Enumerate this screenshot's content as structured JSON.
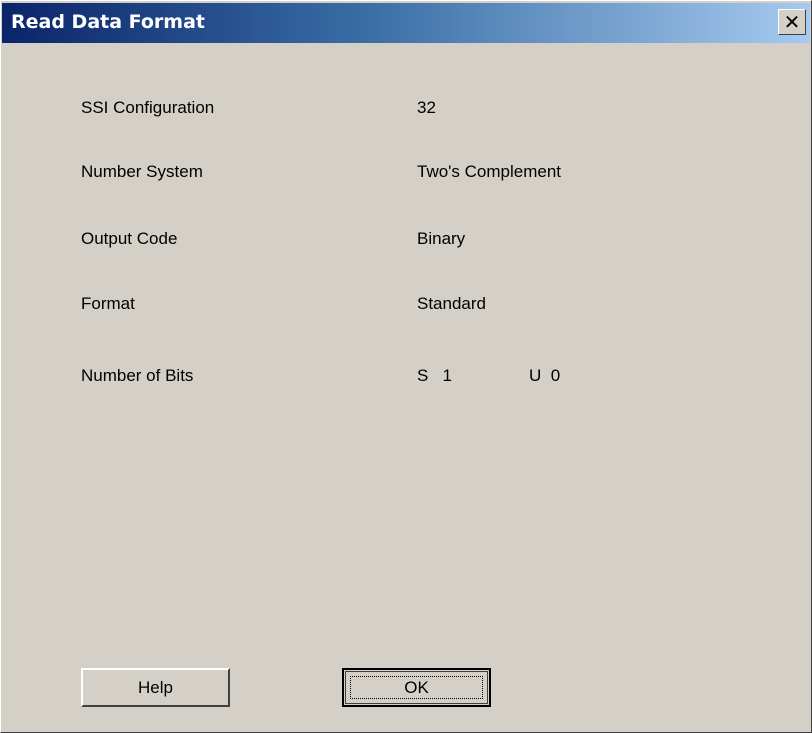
{
  "window": {
    "title": "Read Data Format",
    "close_glyph": "✕"
  },
  "rows": [
    {
      "label": "SSI Configuration",
      "value": "32"
    },
    {
      "label": "Number System",
      "value": "Two's Complement"
    },
    {
      "label": "Output Code",
      "value": "Binary"
    },
    {
      "label": "Format",
      "value": "Standard"
    },
    {
      "label": "Number of Bits",
      "value": "S   1",
      "value2": "U  0"
    }
  ],
  "buttons": {
    "help": "Help",
    "ok": "OK"
  },
  "colors": {
    "face": "#d4d0c8",
    "title_start": "#0a246a",
    "title_end": "#a6caf0"
  }
}
